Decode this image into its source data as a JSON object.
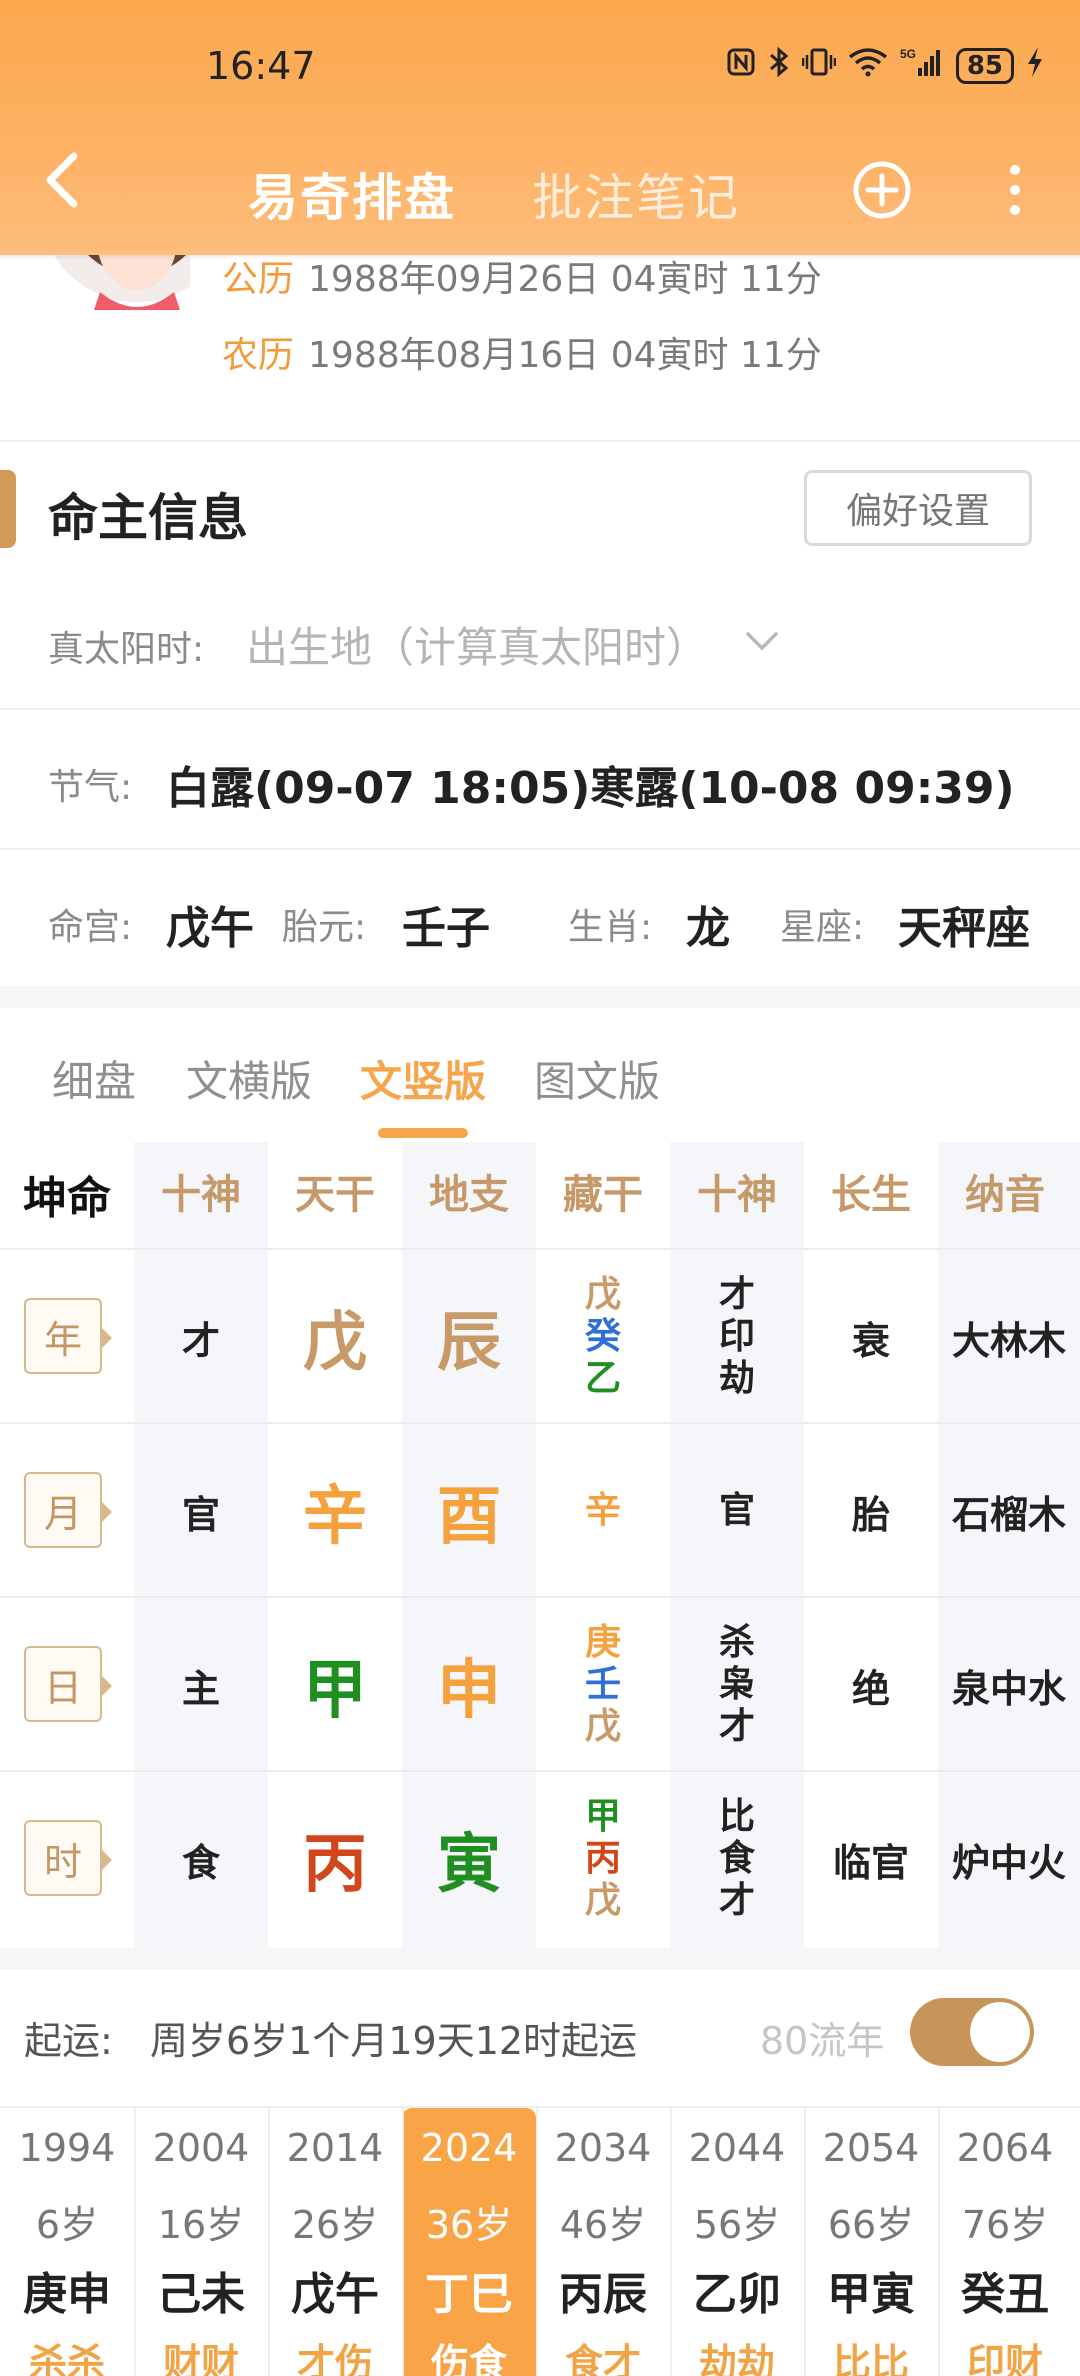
{
  "status": {
    "time": "16:47",
    "battery": "85",
    "network": "5G"
  },
  "nav": {
    "title": "易奇排盘",
    "subtitle": "批注笔记"
  },
  "birth": {
    "solar_label": "公历",
    "solar_value": "1988年09月26日 04寅时 11分",
    "lunar_label": "农历",
    "lunar_value": "1988年08月16日 04寅时 11分"
  },
  "owner": {
    "section_title": "命主信息",
    "pref_button": "偏好设置",
    "solar_time_label": "真太阳时:",
    "solar_time_placeholder": "出生地（计算真太阳时）",
    "jieqi_label": "节气:",
    "jieqi_value": "白露(09-07 18:05)寒露(10-08 09:39)",
    "minggong_label": "命宫:",
    "minggong_value": "戊午",
    "taiyuan_label": "胎元:",
    "taiyuan_value": "壬子",
    "shengxiao_label": "生肖:",
    "shengxiao_value": "龙",
    "xingzuo_label": "星座:",
    "xingzuo_value": "天秤座"
  },
  "tabs": [
    "细盘",
    "文横版",
    "文竖版",
    "图文版"
  ],
  "active_tab": 2,
  "chart": {
    "headers": [
      "坤命",
      "十神",
      "天干",
      "地支",
      "藏干",
      "十神",
      "长生",
      "纳音"
    ],
    "rows": [
      {
        "pillar": "年",
        "shishen": "才",
        "gan": "戊",
        "zhi": "辰",
        "canggan": [
          "戊",
          "癸",
          "乙"
        ],
        "cang_shishen": [
          "才",
          "印",
          "劫"
        ],
        "changsheng": "衰",
        "nayin": "大林木"
      },
      {
        "pillar": "月",
        "shishen": "官",
        "gan": "辛",
        "zhi": "酉",
        "canggan": [
          "辛"
        ],
        "cang_shishen": [
          "官"
        ],
        "changsheng": "胎",
        "nayin": "石榴木"
      },
      {
        "pillar": "日",
        "shishen": "主",
        "gan": "甲",
        "zhi": "申",
        "canggan": [
          "庚",
          "壬",
          "戊"
        ],
        "cang_shishen": [
          "杀",
          "枭",
          "才"
        ],
        "changsheng": "绝",
        "nayin": "泉中水"
      },
      {
        "pillar": "时",
        "shishen": "食",
        "gan": "丙",
        "zhi": "寅",
        "canggan": [
          "甲",
          "丙",
          "戊"
        ],
        "cang_shishen": [
          "比",
          "食",
          "才"
        ],
        "changsheng": "临官",
        "nayin": "炉中火"
      }
    ],
    "colors": {
      "earth": "#c89a68",
      "metal": "#f5a13e",
      "wood": "#1f8f22",
      "water": "#2f6fd6",
      "fire": "#d2461b"
    }
  },
  "luck": {
    "label": "起运:",
    "text": "周岁6岁1个月19天12时起运",
    "liunian_label": "80流年",
    "toggle_on": true,
    "cycles": [
      {
        "year": "1994",
        "age": "6岁",
        "ganzhi": "庚申",
        "shishen": "杀杀"
      },
      {
        "year": "2004",
        "age": "16岁",
        "ganzhi": "己未",
        "shishen": "财财"
      },
      {
        "year": "2014",
        "age": "26岁",
        "ganzhi": "戊午",
        "shishen": "才伤"
      },
      {
        "year": "2024",
        "age": "36岁",
        "ganzhi": "丁巳",
        "shishen": "伤食"
      },
      {
        "year": "2034",
        "age": "46岁",
        "ganzhi": "丙辰",
        "shishen": "食才"
      },
      {
        "year": "2044",
        "age": "56岁",
        "ganzhi": "乙卯",
        "shishen": "劫劫"
      },
      {
        "year": "2054",
        "age": "66岁",
        "ganzhi": "甲寅",
        "shishen": "比比"
      },
      {
        "year": "2064",
        "age": "76岁",
        "ganzhi": "癸丑",
        "shishen": "印财"
      }
    ],
    "active_index": 3
  }
}
